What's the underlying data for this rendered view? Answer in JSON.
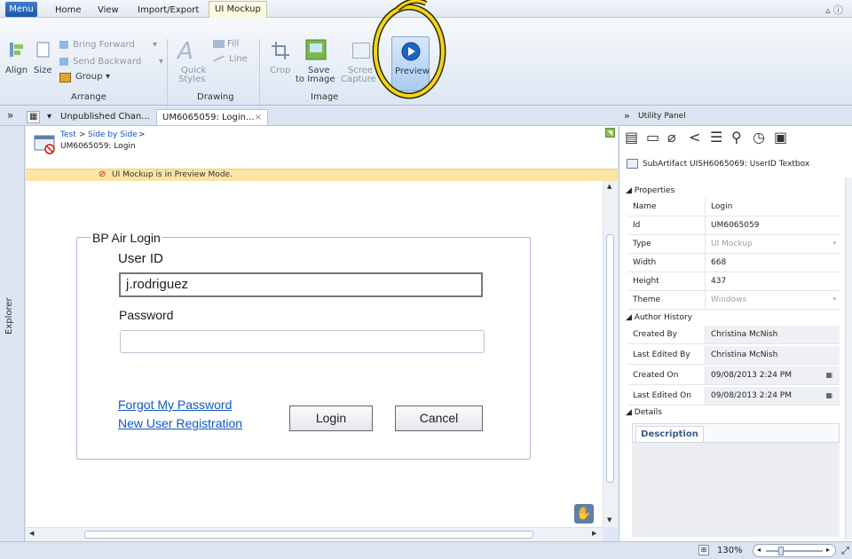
{
  "menubar": {
    "menu_label": "Menu",
    "tabs": [
      "Home",
      "View",
      "Import/Export",
      "UI Mockup"
    ]
  },
  "ribbon": {
    "arrange": {
      "align": "Align",
      "size": "Size",
      "bring_forward": "Bring Forward",
      "send_backward": "Send Backward",
      "group": "Group",
      "label": "Arrange"
    },
    "drawing": {
      "quick_styles_1": "Quick",
      "quick_styles_2": "Styles",
      "fill": "Fill",
      "line": "Line",
      "label": "Drawing"
    },
    "image": {
      "crop": "Crop",
      "save_1": "Save",
      "save_2": "to Image",
      "screen_1": "Scree",
      "screen_2": "Capture",
      "label": "Image"
    },
    "preview": "Preview"
  },
  "docbar": {
    "tab1": "Unpublished Chan...",
    "tab2": "UM6065059: Login...",
    "close": "×"
  },
  "breadcrumb": {
    "part1": "Test",
    "part2": "Side by Side",
    "title": "UM6065059: Login"
  },
  "banner": "UI Mockup is in Preview Mode.",
  "explorer_label": "Explorer",
  "mockup": {
    "legend": "BP Air Login",
    "user_id_label": "User ID",
    "user_id_value": "j.rodriguez",
    "password_label": "Password",
    "password_value": "",
    "forgot_link": "Forgot My Password",
    "register_link": "New User Registration",
    "login_button": "Login",
    "cancel_button": "Cancel"
  },
  "utility": {
    "title": "Utility Panel",
    "subartifact": "SubArtifact UISH6065069: UserID Textbox",
    "properties_header": "Properties",
    "properties": [
      {
        "name": "Name",
        "value": "Login",
        "readonly": false
      },
      {
        "name": "Id",
        "value": "UM6065059",
        "readonly": false
      },
      {
        "name": "Type",
        "value": "UI Mockup",
        "readonly": false,
        "dropdown": true
      },
      {
        "name": "Width",
        "value": "668",
        "readonly": false
      },
      {
        "name": "Height",
        "value": "437",
        "readonly": false
      },
      {
        "name": "Theme",
        "value": "Windows",
        "readonly": false,
        "dropdown": true
      }
    ],
    "author_header": "Author History",
    "author": [
      {
        "name": "Created By",
        "value": "Christina McNish",
        "readonly": true
      },
      {
        "name": "Last Edited By",
        "value": "Christina McNish",
        "readonly": true
      },
      {
        "name": "Created On",
        "value": "09/08/2013 2:24 PM",
        "readonly": true,
        "calendar": true
      },
      {
        "name": "Last Edited On",
        "value": "09/08/2013 2:24 PM",
        "readonly": true,
        "calendar": true
      }
    ],
    "details_header": "Details",
    "description_tab": "Description"
  },
  "status": {
    "zoom": "130%"
  }
}
